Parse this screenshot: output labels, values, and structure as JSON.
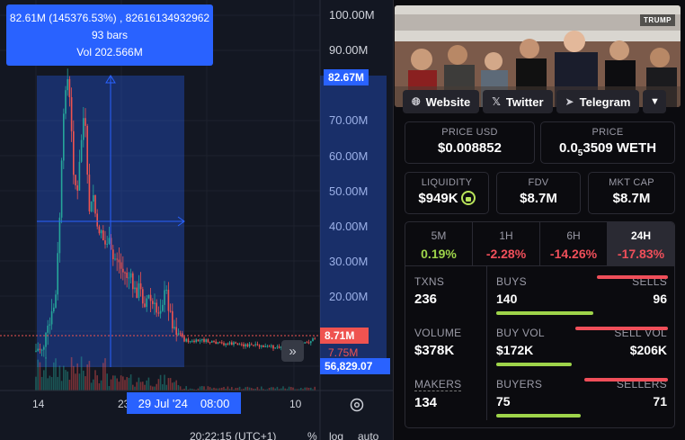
{
  "chart": {
    "tooltip": {
      "line1": "82.61M (145376.53%) , 82616134932962",
      "line2": "93 bars",
      "line3": "Vol 202.566M"
    },
    "price_scale": [
      "100.00M",
      "90.00M",
      "70.00M",
      "60.00M",
      "50.00M",
      "40.00M",
      "30.00M",
      "20.00M"
    ],
    "crosshair_price": "82.67M",
    "current_price": "8.71M",
    "secondary_price": "7.75M",
    "volume_value": "56,829.07",
    "time_labels": {
      "t14": "14",
      "t23": "23",
      "t10": "10"
    },
    "crosshair_date": "29 Jul '24",
    "crosshair_time": "08:00",
    "scroll_label": "»",
    "bottom": {
      "clock": "20:22:15 (UTC+1)",
      "percent": "%",
      "log": "log",
      "auto": "auto"
    },
    "colors": {
      "up": "#26a69a",
      "down": "#ef5350",
      "accent": "#2962ff"
    }
  },
  "token": {
    "banner_logo": "TRUMP",
    "socials": [
      {
        "label": "Website",
        "icon": "globe-icon"
      },
      {
        "label": "Twitter",
        "icon": "x-logo-icon"
      },
      {
        "label": "Telegram",
        "icon": "telegram-icon"
      }
    ],
    "price_usd": {
      "label": "PRICE USD",
      "value": "$0.008852"
    },
    "price_native": {
      "label": "PRICE",
      "value_prefix": "0.0",
      "subscript": "5",
      "value_suffix": "3509 WETH"
    },
    "liquidity": {
      "label": "LIQUIDITY",
      "value": "$949K"
    },
    "fdv": {
      "label": "FDV",
      "value": "$8.7M"
    },
    "mkt_cap": {
      "label": "MKT CAP",
      "value": "$8.7M"
    },
    "periods": [
      {
        "label": "5M",
        "value": "0.19%",
        "color": "#9ed44a"
      },
      {
        "label": "1H",
        "value": "-2.28%",
        "color": "#f04f5a"
      },
      {
        "label": "6H",
        "value": "-14.26%",
        "color": "#f04f5a"
      },
      {
        "label": "24H",
        "value": "-17.83%",
        "color": "#f04f5a"
      }
    ],
    "txns": {
      "label": "TXNS",
      "value": "236"
    },
    "buys": {
      "label": "BUYS",
      "value": "140"
    },
    "sells": {
      "label": "SELLS",
      "value": "96"
    },
    "volume": {
      "label": "VOLUME",
      "value": "$378K"
    },
    "buy_vol": {
      "label": "BUY VOL",
      "value": "$172K"
    },
    "sell_vol": {
      "label": "SELL VOL",
      "value": "$206K"
    },
    "makers": {
      "label": "MAKERS",
      "value": "134"
    },
    "buyers": {
      "label": "BUYERS",
      "value": "75"
    },
    "sellers": {
      "label": "SELLERS",
      "value": "71"
    }
  }
}
